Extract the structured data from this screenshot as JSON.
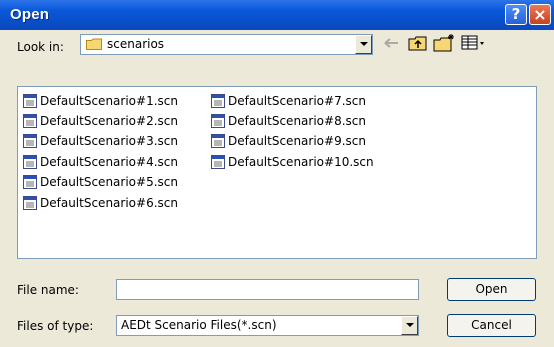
{
  "window": {
    "title": "Open",
    "help_glyph": "?",
    "close_glyph": "×"
  },
  "lookin": {
    "label": "Look in:",
    "value": "scenarios"
  },
  "toolbar": {
    "icons": [
      "back-arrow-icon",
      "up-folder-icon",
      "new-folder-icon",
      "view-menu-icon"
    ]
  },
  "files": {
    "col1": [
      "DefaultScenario#1.scn",
      "DefaultScenario#2.scn",
      "DefaultScenario#3.scn",
      "DefaultScenario#4.scn",
      "DefaultScenario#5.scn",
      "DefaultScenario#6.scn"
    ],
    "col2": [
      "DefaultScenario#7.scn",
      "DefaultScenario#8.scn",
      "DefaultScenario#9.scn",
      "DefaultScenario#10.scn"
    ]
  },
  "filename": {
    "label": "File name:",
    "value": ""
  },
  "filetype": {
    "label": "Files of type:",
    "value": "AEDt Scenario Files(*.scn)"
  },
  "buttons": {
    "open": "Open",
    "cancel": "Cancel"
  }
}
